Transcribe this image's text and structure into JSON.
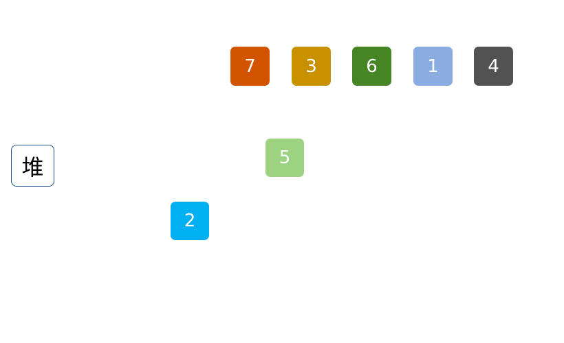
{
  "heap_button": {
    "label": "堆",
    "border_color": "#1f4e8c"
  },
  "row": [
    {
      "value": "7",
      "color": "#d35400"
    },
    {
      "value": "3",
      "color": "#c99100"
    },
    {
      "value": "6",
      "color": "#458523"
    },
    {
      "value": "1",
      "color": "#8aace0"
    },
    {
      "value": "4",
      "color": "#525252"
    }
  ],
  "floating": [
    {
      "value": "5",
      "color": "#9ed283"
    },
    {
      "value": "2",
      "color": "#00b0f0"
    }
  ]
}
